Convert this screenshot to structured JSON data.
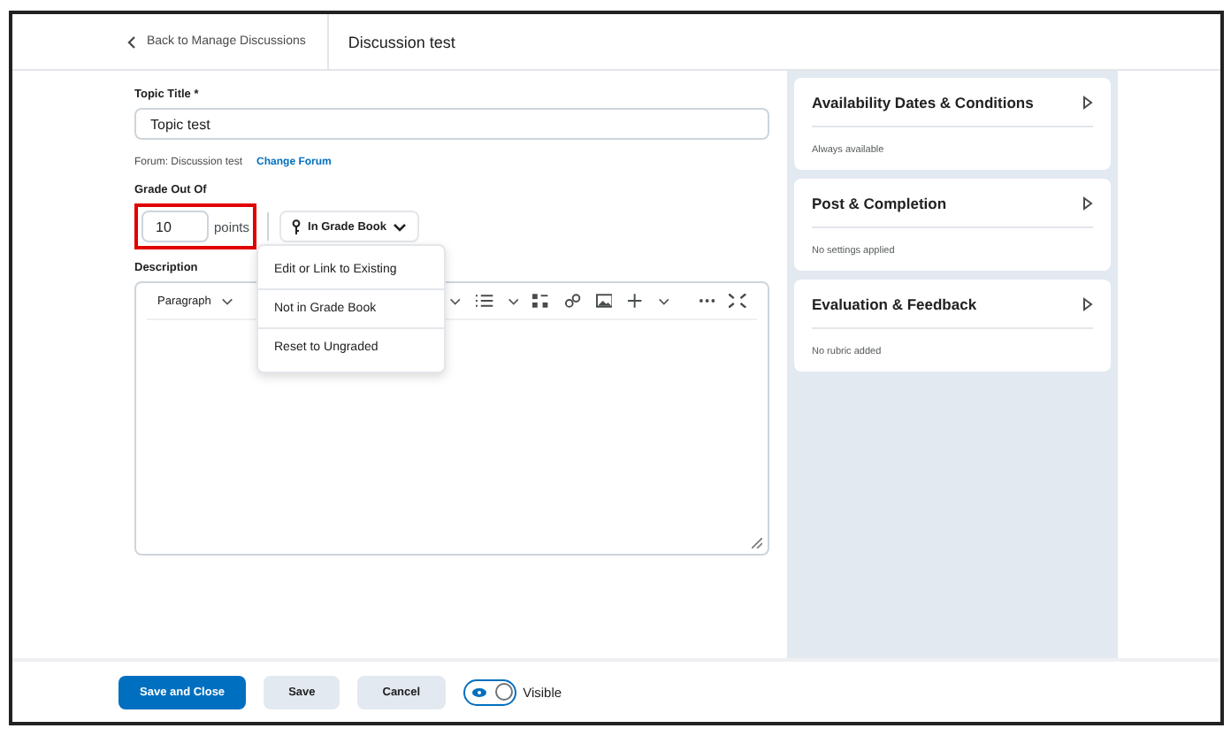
{
  "header": {
    "back_link": "Back to Manage Discussions",
    "title": "Discussion test"
  },
  "topic_title": {
    "label": "Topic Title",
    "required_mark": "*",
    "value": "Topic test"
  },
  "forum": {
    "text": "Forum: Discussion test",
    "link": "Change Forum"
  },
  "grade": {
    "label": "Grade Out Of",
    "value": "10",
    "unit": "points",
    "highlighted": true,
    "grade_book_button": "In Grade Book"
  },
  "grade_menu": {
    "items": [
      {
        "label": "Edit or Link to Existing"
      },
      {
        "label": "Not in Grade Book"
      },
      {
        "label": "Reset to Ungraded"
      }
    ]
  },
  "description": {
    "label": "Description",
    "format_dropdown": "Paragraph"
  },
  "side_panels": [
    {
      "title": "Availability Dates & Conditions",
      "summary": "Always available"
    },
    {
      "title": "Post & Completion",
      "summary": "No settings applied"
    },
    {
      "title": "Evaluation & Feedback",
      "summary": "No rubric added"
    }
  ],
  "footer": {
    "buttons": [
      {
        "label": "Save and Close",
        "kind": "primary"
      },
      {
        "label": "Save",
        "kind": "secondary"
      },
      {
        "label": "Cancel",
        "kind": "secondary"
      }
    ],
    "visibility": {
      "label": "Visible",
      "on": true
    }
  }
}
